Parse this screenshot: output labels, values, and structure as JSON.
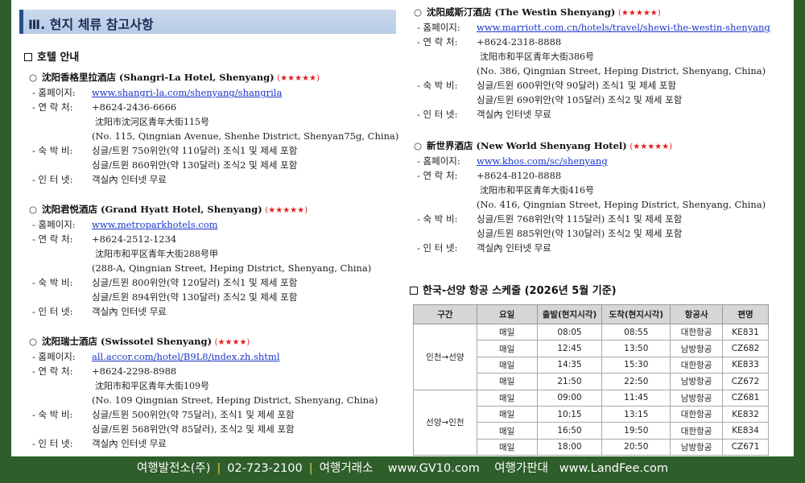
{
  "section_title": "Ⅲ. 현지 체류 참고사항",
  "hotel_heading": "호텔 안내",
  "labels": {
    "homepage": "- 홈페이지:",
    "contact": "- 연 락 처:",
    "rate": "- 숙 박 비:",
    "internet": "- 인 터 넷:"
  },
  "hotels": [
    {
      "bullet": "○",
      "name": "沈阳香格里拉酒店 (Shangri-La Hotel, Shenyang)",
      "stars": "(★★★★★)",
      "url": "www.shangri-la.com/shenyang/shangrila",
      "phone": "+8624-2436-6666",
      "addr_cn": "沈阳市沈河区青年大街115号",
      "addr_en": "(No. 115, Qingnian Avenue, Shenhe District, Shenyan75g, China)",
      "rate1": "싱글/트윈  750위안(약 110달러) 조식1 및 제세 포함",
      "rate2": "싱글/트윈  860위안(약 130달러) 조식2 및 제세 포함",
      "internet": "객실內 인터넷 무료"
    },
    {
      "bullet": "○",
      "name": "沈阳君悦酒店 (Grand Hyatt Hotel, Shenyang)",
      "stars": "(★★★★★)",
      "url": "www.metroparkhotels.com",
      "phone": "+8624-2512-1234",
      "addr_cn": "沈阳市和平区青年大街288号甲",
      "addr_en": "(288-A, Qingnian Street, Heping District, Shenyang, China)",
      "rate1": "싱글/트윈  800위안(약 120달러) 조식1 및 제세 포함",
      "rate2": "싱글/트윈  894위안(약 130달러) 조식2 및 제세 포함",
      "internet": "객실內 인터넷 무료"
    },
    {
      "bullet": "○",
      "name": "沈阳瑞士酒店 (Swissotel Shenyang)",
      "stars": "(★★★★)",
      "url": "all.accor.com/hotel/B9L8/index.zh.shtml",
      "phone": "+8624-2298-8988",
      "addr_cn": "沈阳市和平区青年大街109号",
      "addr_en": "(No. 109 Qingnian Street, Heping District, Shenyang, China)",
      "rate1": "싱글/트윈  500위안(약 75달러), 조식1 및 제세 포함",
      "rate2": "싱글/트윈  568위안(약 85달러), 조식2 및 제세 포함",
      "internet": "객실內 인터넷 무료"
    },
    {
      "bullet": "○",
      "name": "沈阳威斯汀酒店 (The Westin Shenyang)",
      "stars": "(★★★★★)",
      "url": "www.marriott.com.cn/hotels/travel/shewi-the-westin-shenyang",
      "phone": "+8624-2318-8888",
      "addr_cn": "沈阳市和平区青年大街386号",
      "addr_en": "(No. 386, Qingnian Street, Heping District, Shenyang, China)",
      "rate1": "싱글/트윈  600위안(약 90달러) 조식1 및 제세 포함",
      "rate2": "싱글/트윈  690위안(약 105달러) 조식2 및 제세 포함",
      "internet": "객실內 인터넷 무료"
    },
    {
      "bullet": "○",
      "name": "新世界酒店 (New World Shenyang Hotel)",
      "stars": "(★★★★★)",
      "url": "www.khos.com/sc/shenyang",
      "phone": "+8624-8120-8888",
      "addr_cn": "沈阳市和平区青年大街416号",
      "addr_en": "(No. 416, Qingnian Street, Heping District, Shenyang, China)",
      "rate1": "싱글/트윈  768위안(약 115달러) 조식1 및 제세 포함",
      "rate2": "싱글/트윈  885위안(약 130달러) 조식2 및 제세 포함",
      "internet": "객실內 인터넷 무료"
    }
  ],
  "schedule": {
    "heading": "한국-선양 항공 스케줄 (2026년 5월 기준)",
    "headers": [
      "구간",
      "요일",
      "출발(현지시각)",
      "도착(현지시각)",
      "항공사",
      "편명"
    ],
    "groups": [
      {
        "route": "인천→선양",
        "rows": [
          [
            "매일",
            "08:05",
            "08:55",
            "대한항공",
            "KE831"
          ],
          [
            "매일",
            "12:45",
            "13:50",
            "남방항공",
            "CZ682"
          ],
          [
            "매일",
            "14:35",
            "15:30",
            "대한항공",
            "KE833"
          ],
          [
            "매일",
            "21:50",
            "22:50",
            "남방항공",
            "CZ672"
          ]
        ]
      },
      {
        "route": "선양→인천",
        "rows": [
          [
            "매일",
            "09:00",
            "11:45",
            "남방항공",
            "CZ681"
          ],
          [
            "매일",
            "10:15",
            "13:15",
            "대한항공",
            "KE832"
          ],
          [
            "매일",
            "16:50",
            "19:50",
            "대한항공",
            "KE834"
          ],
          [
            "매일",
            "18:00",
            "20:50",
            "남방항공",
            "CZ671"
          ]
        ]
      }
    ]
  },
  "footer": {
    "company": "여행발전소(주)",
    "sep1": "|",
    "phone": "02-723-2100",
    "sep2": "|",
    "exchange_label": "여행거래소",
    "exchange_url": "www.GV10.com",
    "price_label": "여행가판대",
    "price_url": "www.LandFee.com"
  },
  "colors": {
    "frame": "#2e5e2a",
    "header_band": "#c9d9ee",
    "header_accent": "#2a4f8f",
    "link": "#1a35c9",
    "star": "#e02020",
    "footer_sep": "#f2c744"
  }
}
